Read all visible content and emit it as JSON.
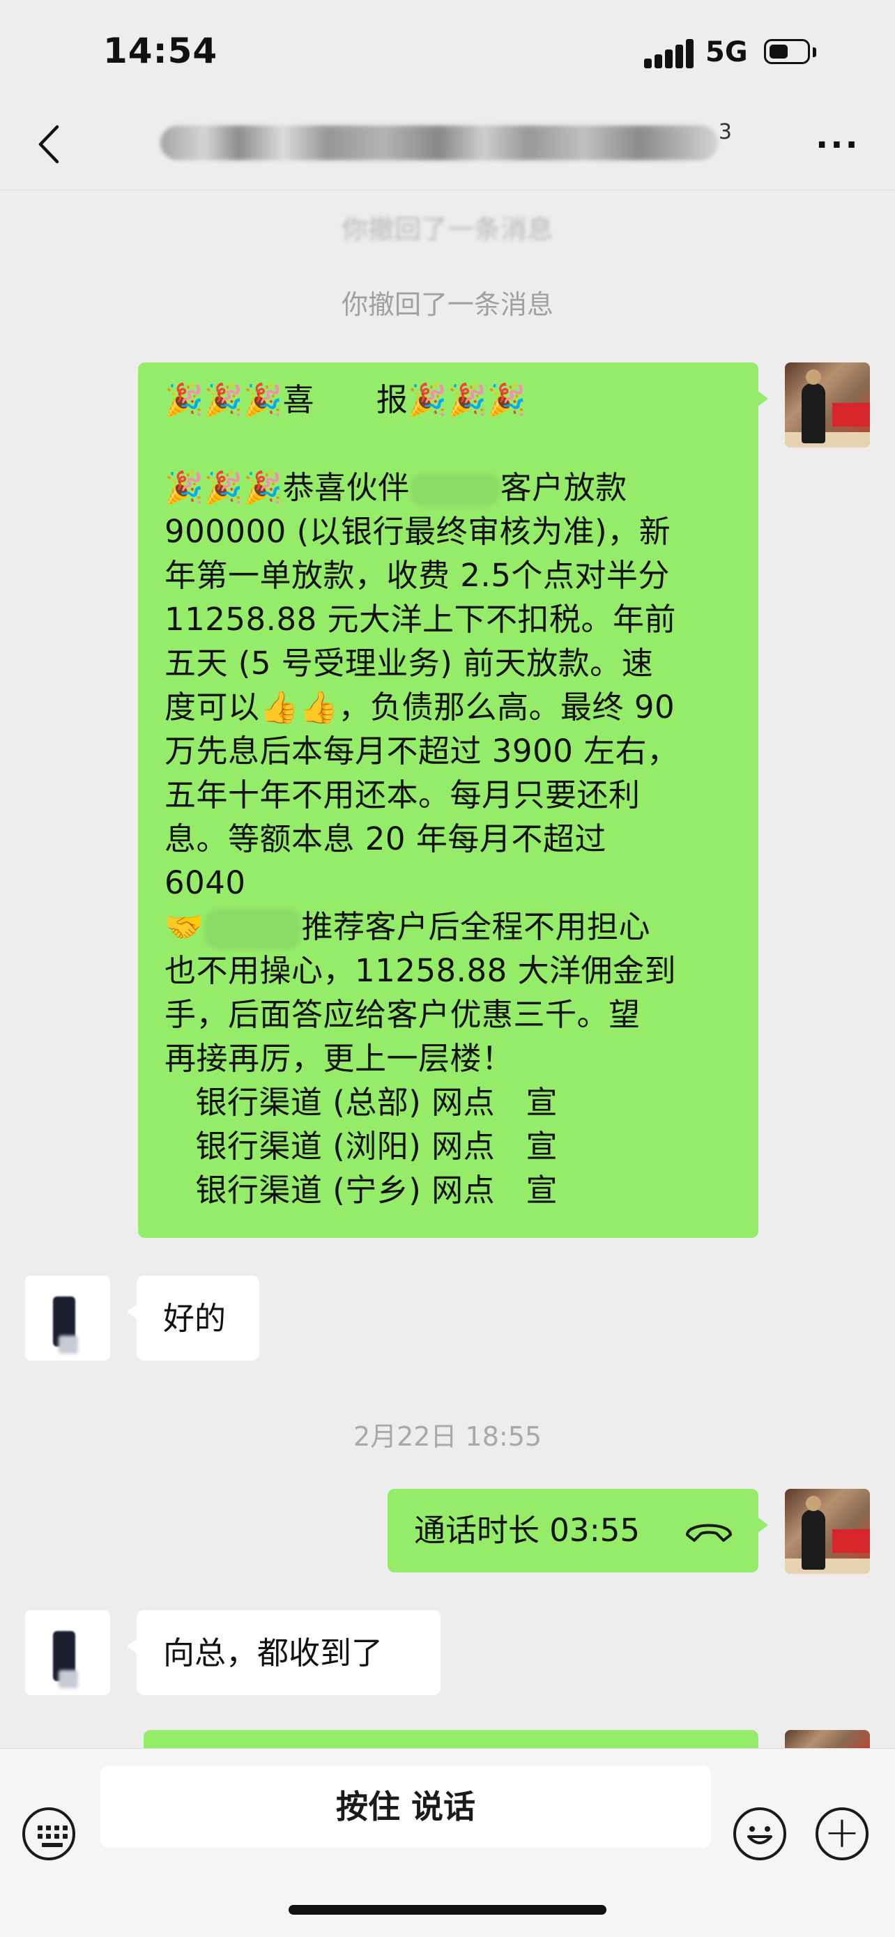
{
  "status_bar": {
    "time": "14:54",
    "network": "5G"
  },
  "nav": {
    "title_suffix": "3"
  },
  "chat": {
    "system_faded": "你撤回了一条消息",
    "system_recall": "你撤回了一条消息",
    "announcement": {
      "heading_left": "🎉🎉🎉喜",
      "heading_right": "报🎉🎉🎉",
      "l1_a": "🎉🎉🎉恭喜伙伴",
      "l1_b": "客户放款",
      "l2": "900000 (以银行最终审核为准)，新",
      "l3": "年第一单放款，收费 2.5个点对半分",
      "l4": "11258.88 元大洋上下不扣税。年前",
      "l5": "五天 (5 号受理业务) 前天放款。速",
      "l6": "度可以👍👍，负债那么高。最终 90",
      "l7": "万先息后本每月不超过 3900 左右，",
      "l8": "五年十年不用还本。每月只要还利",
      "l9": "息。等额本息 20 年每月不超过",
      "l10": "6040",
      "l11_a": "🤝",
      "l11_b": "推荐客户后全程不用担心",
      "l12": "也不用操心，11258.88 大洋佣金到",
      "l13": "手，后面答应给客户优惠三千。望",
      "l14": "再接再厉，更上一层楼！",
      "l15": "   银行渠道 (总部) 网点   宣",
      "l16": "   银行渠道 (浏阳) 网点   宣",
      "l17": "   银行渠道 (宁乡) 网点   宣"
    },
    "reply_ok": "好的",
    "timestamp": "2月22日 18:55",
    "call_label": "通话时长 03:55",
    "reply_received": "向总，都收到了"
  },
  "input": {
    "hold_to_talk": "按住 说话"
  },
  "colors": {
    "bubble_green": "#95ec69",
    "background": "#ededed"
  }
}
